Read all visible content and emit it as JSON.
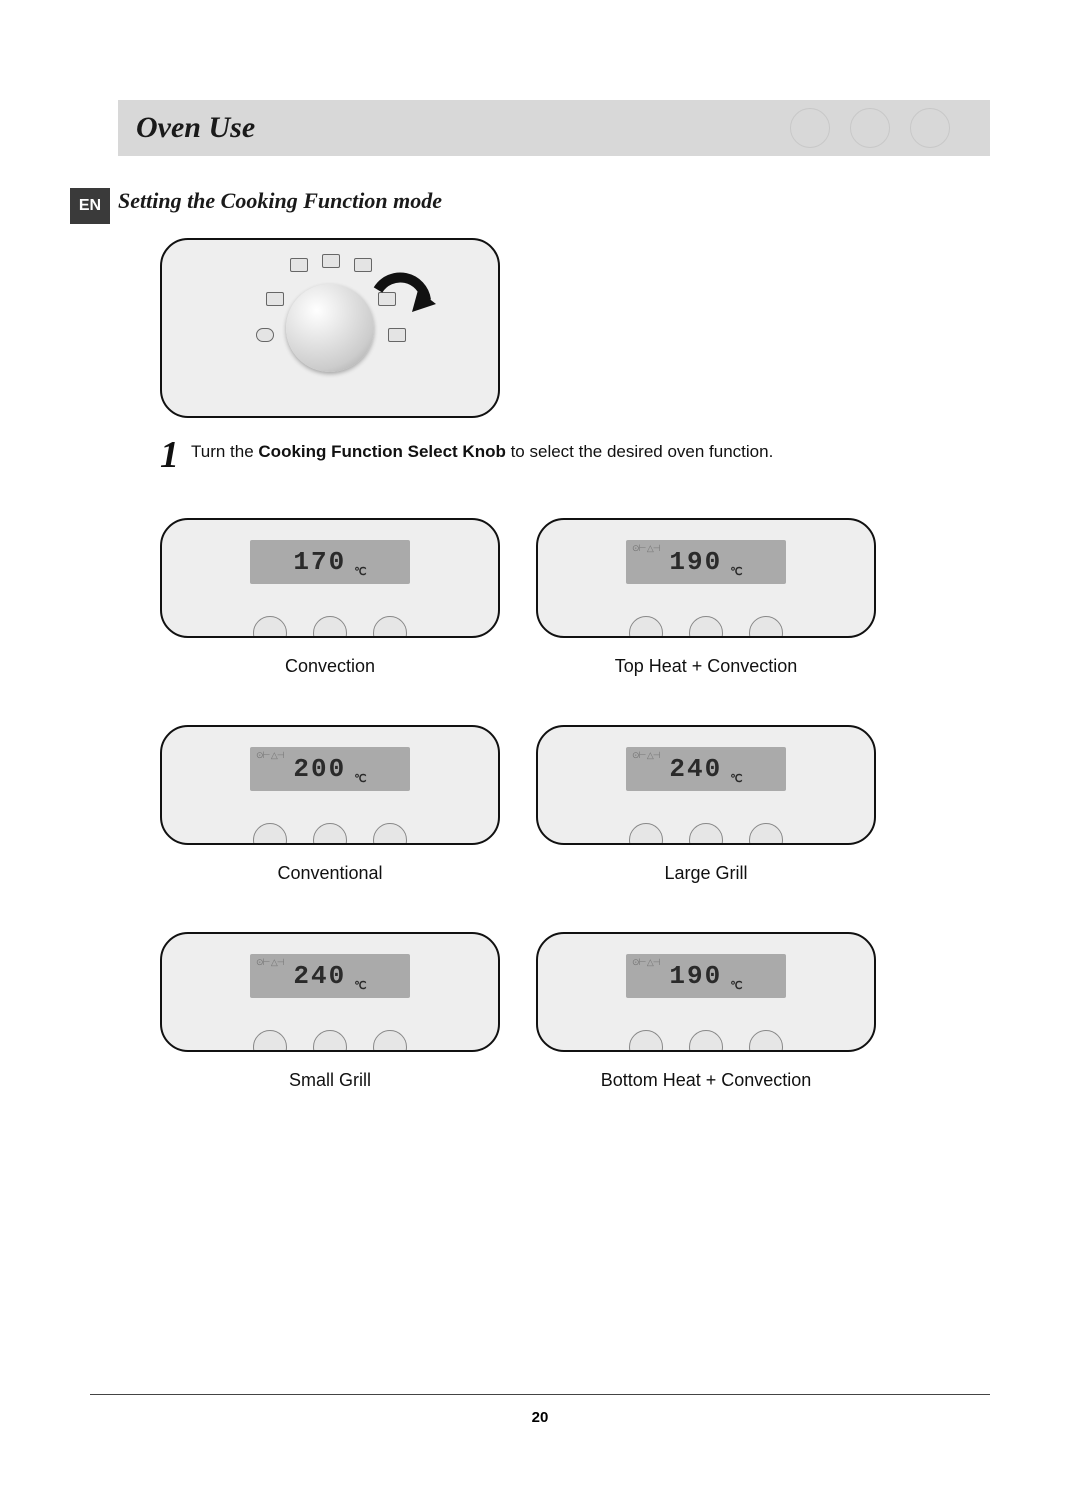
{
  "lang_badge": "EN",
  "page_title": "Oven Use",
  "subtitle": "Setting the Cooking Function mode",
  "step": {
    "number": "1",
    "text_before": "Turn the ",
    "bold": "Cooking Function Select Knob",
    "text_after": " to select the desired oven function."
  },
  "modes": [
    {
      "display": "170",
      "unit": "℃",
      "label": "Convection",
      "show_ghost": false
    },
    {
      "display": "190",
      "unit": "℃",
      "label": "Top Heat + Convection",
      "show_ghost": true
    },
    {
      "display": "200",
      "unit": "℃",
      "label": "Conventional",
      "show_ghost": true
    },
    {
      "display": "240",
      "unit": "℃",
      "label": "Large Grill",
      "show_ghost": true
    },
    {
      "display": "240",
      "unit": "℃",
      "label": "Small Grill",
      "show_ghost": true
    },
    {
      "display": "190",
      "unit": "℃",
      "label": "Bottom Heat + Convection",
      "show_ghost": true
    }
  ],
  "page_number": "20"
}
